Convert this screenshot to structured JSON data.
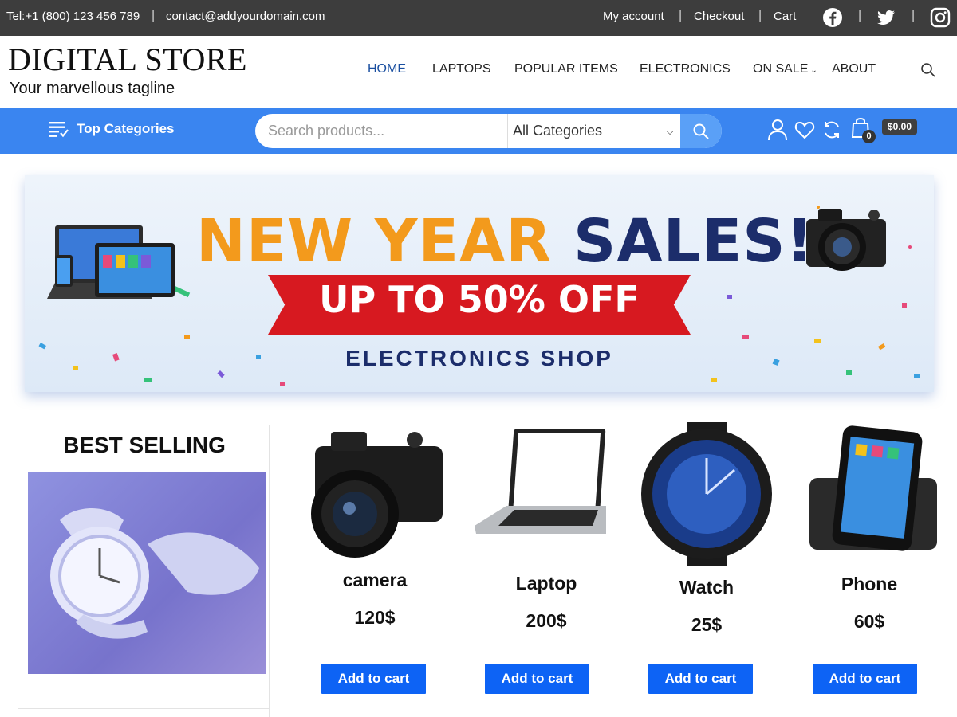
{
  "topbar": {
    "phone": "Tel:+1 (800) 123 456 789",
    "email": "contact@addyourdomain.com",
    "links": [
      "My account",
      "Checkout",
      "Cart"
    ],
    "social_icons": [
      "facebook-icon",
      "twitter-icon",
      "instagram-icon"
    ]
  },
  "header": {
    "logo": "DIGITAL STORE",
    "tagline": "Your marvellous tagline",
    "nav": [
      {
        "label": "HOME",
        "active": true
      },
      {
        "label": "LAPTOPS"
      },
      {
        "label": "POPULAR ITEMS"
      },
      {
        "label": "ELECTRONICS"
      },
      {
        "label": "ON SALE",
        "has_dropdown": true
      },
      {
        "label": "ABOUT"
      }
    ]
  },
  "bluebar": {
    "categories_label": "Top Categories",
    "search_placeholder": "Search products...",
    "category_select": "All Categories",
    "cart_count": "0",
    "cart_total": "$0.00"
  },
  "banner": {
    "word1": "NEW YEAR",
    "word2": "SALES!",
    "ribbon": "UP TO 50% OFF",
    "subtitle": "ELECTRONICS SHOP"
  },
  "best_selling": {
    "title": "BEST SELLING"
  },
  "products": [
    {
      "name": "camera",
      "price": "120$",
      "button": "Add to cart"
    },
    {
      "name": "Laptop",
      "price": "200$",
      "button": "Add to cart"
    },
    {
      "name": "Watch",
      "price": "25$",
      "button": "Add to cart"
    },
    {
      "name": "Phone",
      "price": "60$",
      "button": "Add to cart"
    }
  ],
  "colors": {
    "topbar": "#3d3d3d",
    "bluebar": "#3a85f0",
    "button": "#0d63f5",
    "nav_active": "#1a4fa0",
    "banner_orange": "#f39a1c",
    "banner_navy": "#1c2d6b",
    "banner_red": "#d71920"
  }
}
